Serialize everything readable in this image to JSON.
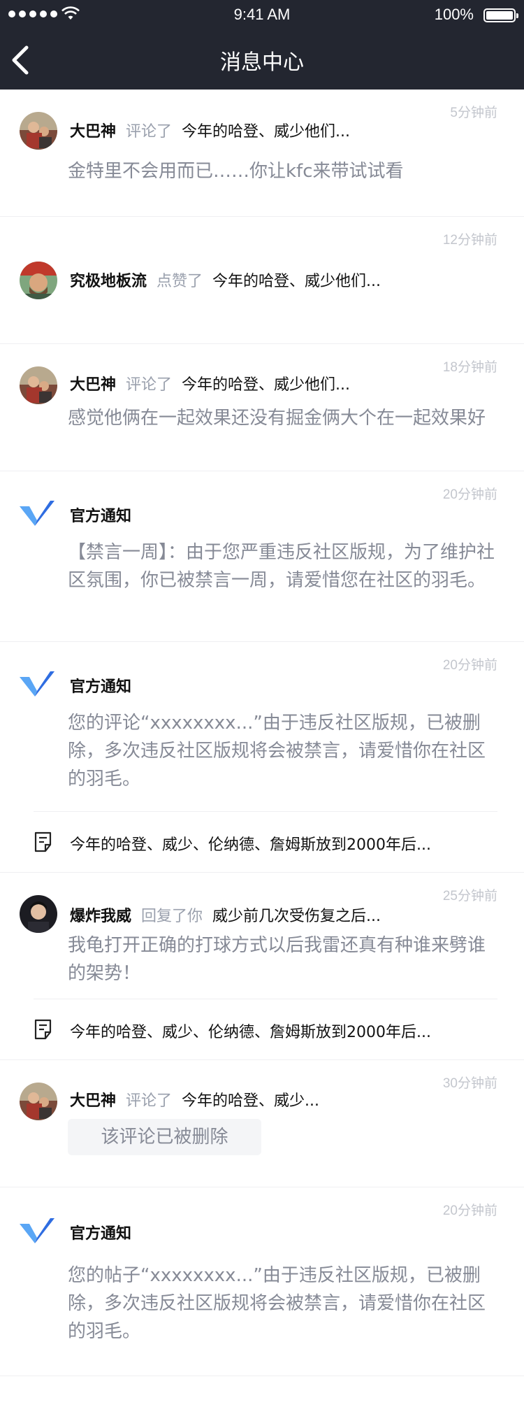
{
  "status_bar": {
    "time": "9:41 AM",
    "battery": "100%"
  },
  "nav": {
    "title": "消息中心"
  },
  "notifications": [
    {
      "time": "5分钟前",
      "name": "大巴神",
      "action": "评论了",
      "target": "今年的哈登、威少他们...",
      "message": "金特里不会用而已……你让kfc来带试试看"
    },
    {
      "time": "12分钟前",
      "name": "究极地板流",
      "action": "点赞了",
      "target": "今年的哈登、威少他们..."
    },
    {
      "time": "18分钟前",
      "name": "大巴神",
      "action": "评论了",
      "target": "今年的哈登、威少他们...",
      "message": "感觉他俩在一起效果还没有掘金俩大个在一起效果好"
    },
    {
      "time": "20分钟前",
      "name": "官方通知",
      "message": "【禁言一周】：由于您严重违反社区版规，为了维护社区氛围，你已被禁言一周，请爱惜您在社区的羽毛。"
    },
    {
      "time": "20分钟前",
      "name": "官方通知",
      "message": "您的评论“xxxxxxxx...”由于违反社区版规，已被删除，多次违反社区版规将会被禁言，请爱惜你在社区的羽毛。",
      "post": "今年的哈登、威少、伦纳德、詹姆斯放到2000年后..."
    },
    {
      "time": "25分钟前",
      "name": "爆炸我威",
      "action": "回复了你",
      "target": "威少前几次受伤复之后...",
      "message": "我龟打开正确的打球方式以后我雷还真有种谁来劈谁的架势！",
      "post": "今年的哈登、威少、伦纳德、詹姆斯放到2000年后..."
    },
    {
      "time": "30分钟前",
      "name": "大巴神",
      "action": "评论了",
      "target": "今年的哈登、威少...",
      "deleted": "该评论已被删除"
    },
    {
      "time": "20分钟前",
      "name": "官方通知",
      "message": "您的帖子“xxxxxxxx...”由于违反社区版规，已被删除，多次违反社区版规将会被禁言，请爱惜你在社区的羽毛。"
    }
  ],
  "icons": {
    "back": "chevron-left-icon",
    "official": "official-logo-icon",
    "post": "document-icon"
  },
  "colors": {
    "nav_bg": "#232630",
    "secondary_text": "#868a96",
    "muted": "#9aa0ad",
    "logo_blue": "#2f6de1"
  }
}
